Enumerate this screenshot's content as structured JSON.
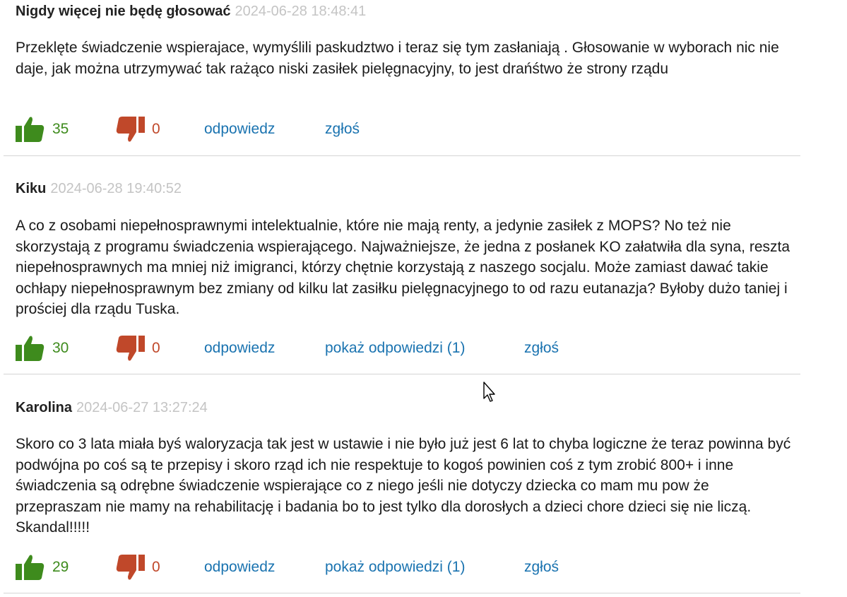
{
  "comments": [
    {
      "author": "Nigdy więcej nie będę głosować",
      "date": "2024-06-28 18:48:41",
      "text": "Przeklęte świadczenie wspierajace, wymyślili paskudztwo i teraz się tym zasłaniają . Głosowanie w wyborach nic nie daje, jak można utrzymywać tak rażąco niski zasiłek pielęgnacyjny, to jest drańśtwo że strony rządu",
      "likes": "35",
      "dislikes": "0",
      "reply_label": "odpowiedz",
      "show_replies_label": "",
      "report_label": "zgłoś"
    },
    {
      "author": "Kiku",
      "date": "2024-06-28 19:40:52",
      "text": "A co z osobami niepełnosprawnymi intelektualnie, które nie mają renty, a jedynie zasiłek z MOPS? No też nie skorzystają z programu świadczenia wspierającego. Najważniejsze, że jedna z posłanek KO załatwiła dla syna, reszta niepełnosprawnych ma mniej niż imigranci, którzy chętnie korzystają z naszego socjalu. Może zamiast dawać takie ochłapy niepełnosprawnym bez zmiany od kilku lat zasiłku pielęgnacyjnego to od razu eutanazja? Byłoby dużo taniej i prościej dla rządu Tuska.",
      "likes": "30",
      "dislikes": "0",
      "reply_label": "odpowiedz",
      "show_replies_label": "pokaż odpowiedzi (1)",
      "report_label": "zgłoś"
    },
    {
      "author": "Karolina",
      "date": "2024-06-27 13:27:24",
      "text": "Skoro co 3 lata miała byś waloryzacja tak jest w ustawie i nie było już jest 6 lat to chyba logiczne że teraz powinna być podwójna po coś są te przepisy i skoro rząd ich nie respektuje to kogoś powinien coś z tym zrobić 800+ i inne świadczenia są odrębne świadczenie wspierające co z niego jeśli nie dotyczy dziecka co mam mu pow że przepraszam nie mamy na rehabilitację i badania bo to jest tylko dla dorosłych a dzieci chore dzieci się nie liczą. Skandal!!!!!",
      "likes": "29",
      "dislikes": "0",
      "reply_label": "odpowiedz",
      "show_replies_label": "pokaż odpowiedzi (1)",
      "report_label": "zgłoś"
    }
  ],
  "icons": {
    "thumb_up": "thumbs-up-icon",
    "thumb_down": "thumbs-down-icon",
    "cursor": "mouse-cursor-icon"
  },
  "colors": {
    "like": "#3e8b1d",
    "dislike": "#c0482a",
    "link": "#1a73b0",
    "date": "#c4c4c4"
  }
}
